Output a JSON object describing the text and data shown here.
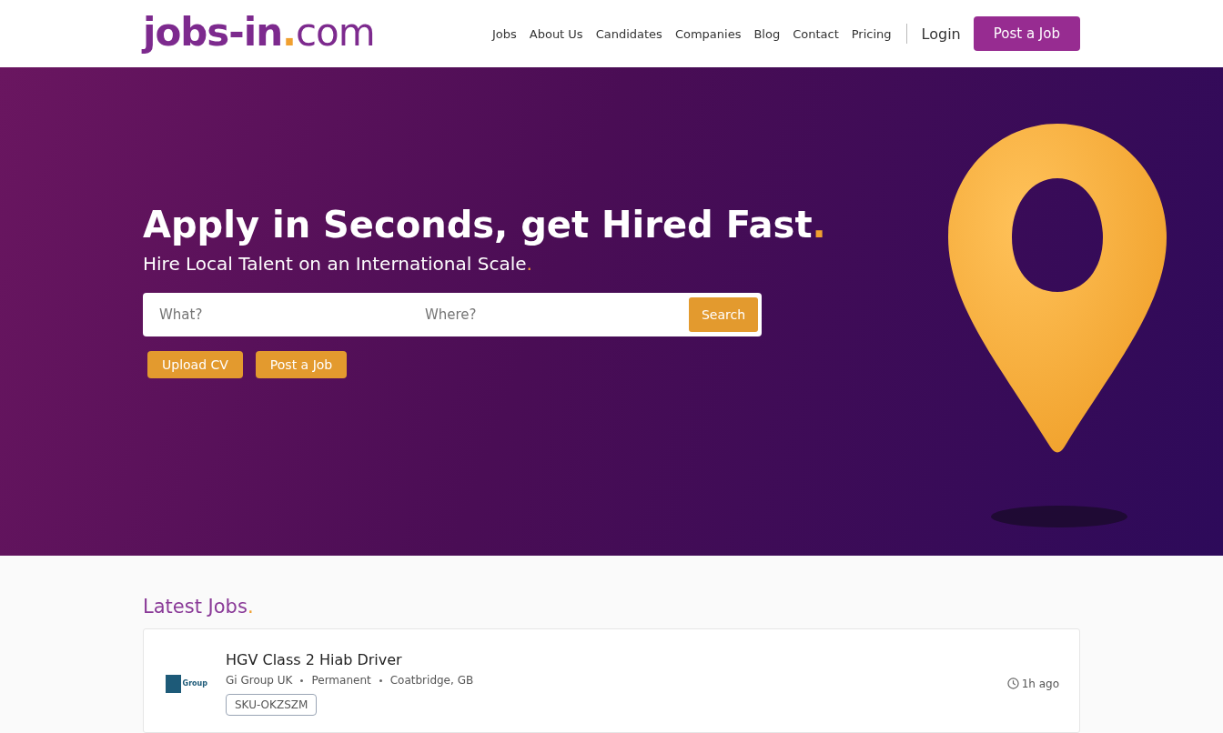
{
  "logo": {
    "name": "jobs-in",
    "accent": ".",
    "suffix": "com"
  },
  "nav": [
    {
      "label": "Jobs"
    },
    {
      "label": "About Us"
    },
    {
      "label": "Candidates"
    },
    {
      "label": "Companies"
    },
    {
      "label": "Blog"
    },
    {
      "label": "Contact"
    },
    {
      "label": "Pricing"
    }
  ],
  "login": "Login",
  "post_job_button": "Post a Job",
  "hero": {
    "headline": "Apply in Seconds, get Hired Fast",
    "headline_accent": ".",
    "subheadline": "Hire Local Talent on an International Scale",
    "subheadline_accent": ".",
    "search": {
      "what_placeholder": "What?",
      "where_placeholder": "Where?",
      "button": "Search"
    },
    "buttons": [
      "Upload CV",
      "Post a Job"
    ]
  },
  "latest_jobs": {
    "heading": "Latest Jobs",
    "heading_accent": ".",
    "jobs": [
      {
        "title": "HGV Class 2 Hiab Driver",
        "company": "Gi Group UK",
        "logo_text": "Group",
        "type": "Permanent",
        "location": "Coatbridge, GB",
        "sku": "SKU-OKZSZM",
        "posted": "1h ago"
      }
    ]
  }
}
